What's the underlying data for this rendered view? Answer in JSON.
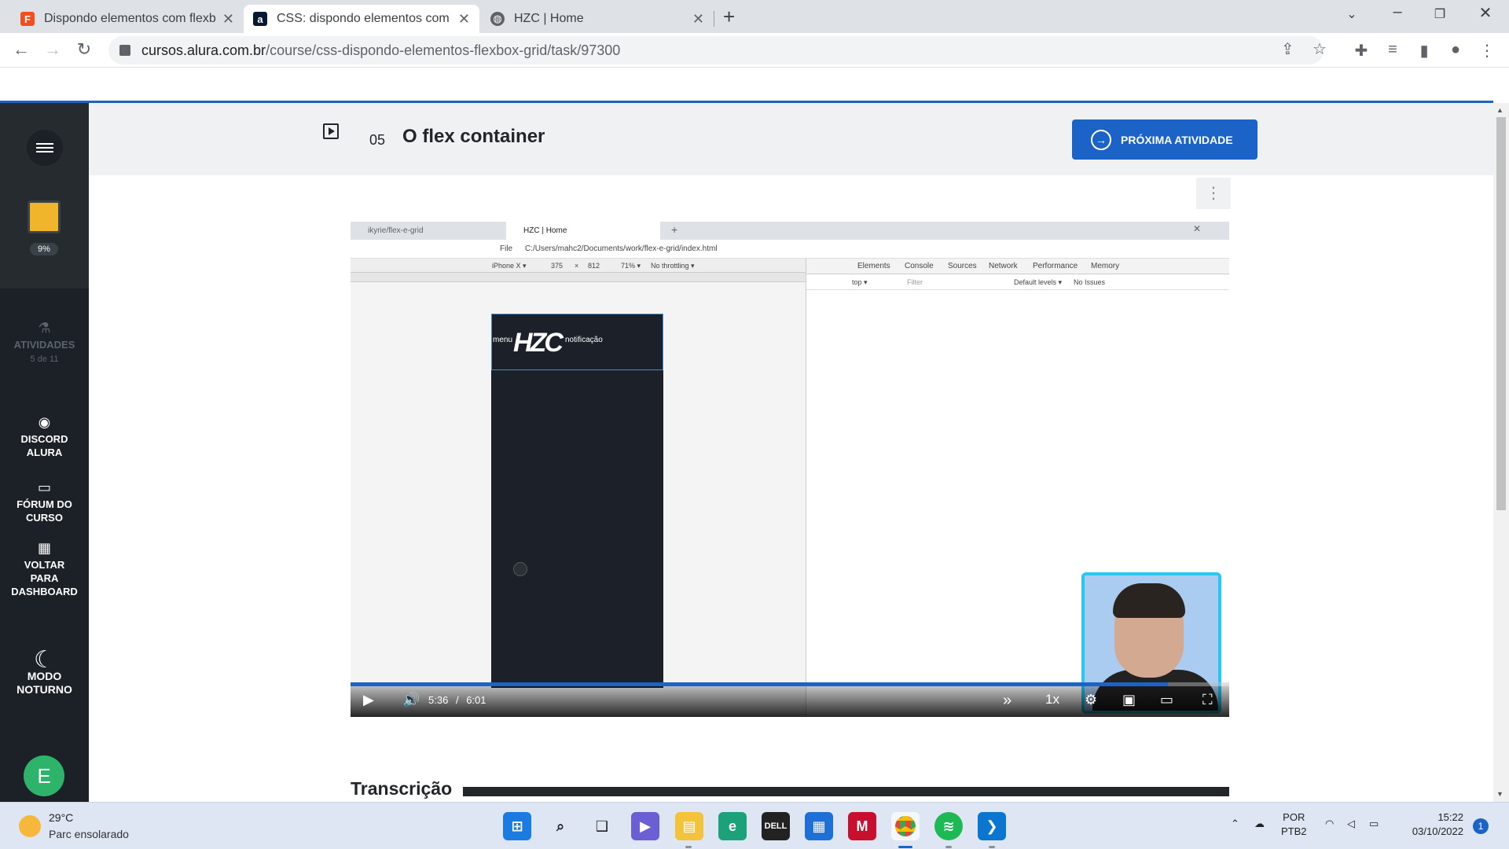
{
  "browser": {
    "tabs": [
      {
        "title": "Dispondo elementos com flexbo",
        "active": false
      },
      {
        "title": "CSS: dispondo elementos com Fl",
        "active": true
      },
      {
        "title": "HZC | Home",
        "active": false
      }
    ],
    "url_host": "cursos.alura.com.br",
    "url_path": "/course/css-dispondo-elementos-flexbox-grid/task/97300"
  },
  "sidebar": {
    "progress_pct": "9%",
    "activities_label": "ATIVIDADES",
    "activities_count": "5 de 11",
    "discord_label_1": "DISCORD",
    "discord_label_2": "ALURA",
    "forum_label_1": "FÓRUM DO",
    "forum_label_2": "CURSO",
    "back_label_1": "VOLTAR",
    "back_label_2": "PARA",
    "back_label_3": "DASHBOARD",
    "night_label_1": "MODO",
    "night_label_2": "NOTURNO",
    "avatar_letter": "E"
  },
  "lesson": {
    "number": "05",
    "title": "O flex container",
    "next_button": "PRÓXIMA ATIVIDADE"
  },
  "video": {
    "inner_tabs": [
      "ikyrie/flex-e-grid",
      "HZC | Home"
    ],
    "inner_url_prefix": "File",
    "inner_url": "C:/Users/mahc2/Documents/work/flex-e-grid/index.html",
    "device": "iPhone X ▾",
    "width": "375",
    "height": "812",
    "zoom": "71% ▾",
    "throttle": "No throttling ▾",
    "devtools_tabs": [
      "Elements",
      "Console",
      "Sources",
      "Network",
      "Performance",
      "Memory"
    ],
    "console_context": "top ▾",
    "console_filter": "Filter",
    "console_levels": "Default levels ▾",
    "console_issues": "No Issues",
    "phone_menu": "menu",
    "phone_notif": "notificação",
    "current_time": "5:36",
    "separator": "/",
    "duration": "6:01",
    "progress": 0.93,
    "speed": "1x"
  },
  "transcript_heading": "Transcrição",
  "taskbar": {
    "temp": "29°C",
    "weather": "Parc ensolarado",
    "lang_1": "POR",
    "lang_2": "PTB2",
    "time": "15:22",
    "date": "03/10/2022",
    "notifications": "1"
  }
}
